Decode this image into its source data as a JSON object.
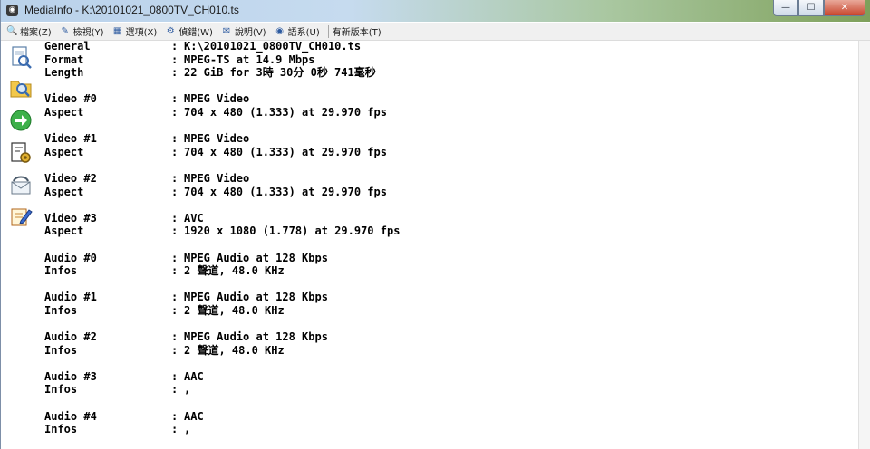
{
  "window": {
    "title": "MediaInfo - K:\\20101021_0800TV_CH010.ts",
    "controls": {
      "minimize": "—",
      "maximize": "☐",
      "close": "✕"
    }
  },
  "menu": [
    {
      "label": "檔案(Z)",
      "icon": "folder-search-icon",
      "glyph": "🔍"
    },
    {
      "label": "檢視(Y)",
      "icon": "view-icon",
      "glyph": "✎"
    },
    {
      "label": "選項(X)",
      "icon": "options-icon",
      "glyph": "▦"
    },
    {
      "label": "偵錯(W)",
      "icon": "debug-icon",
      "glyph": "⚙"
    },
    {
      "label": "說明(V)",
      "icon": "help-icon",
      "glyph": "✉"
    },
    {
      "label": "語系(U)",
      "icon": "language-icon",
      "glyph": "◉"
    },
    {
      "label": "有新版本(T)",
      "icon": "",
      "glyph": ""
    }
  ],
  "sidebar": [
    {
      "name": "open-file-icon"
    },
    {
      "name": "open-folder-icon"
    },
    {
      "name": "export-arrow-icon"
    },
    {
      "name": "preferences-icon"
    },
    {
      "name": "contact-icon"
    },
    {
      "name": "edit-icon"
    }
  ],
  "info": [
    {
      "key": "General",
      "value": "K:\\20101021_0800TV_CH010.ts"
    },
    {
      "key": "Format",
      "value": "MPEG-TS at 14.9 Mbps"
    },
    {
      "key": "Length",
      "value": "22 GiB for 3時 30分 0秒 741毫秒"
    },
    null,
    {
      "key": "Video #0",
      "value": "MPEG Video"
    },
    {
      "key": "Aspect",
      "value": "704 x 480 (1.333) at 29.970 fps"
    },
    null,
    {
      "key": "Video #1",
      "value": "MPEG Video"
    },
    {
      "key": "Aspect",
      "value": "704 x 480 (1.333) at 29.970 fps"
    },
    null,
    {
      "key": "Video #2",
      "value": "MPEG Video"
    },
    {
      "key": "Aspect",
      "value": "704 x 480 (1.333) at 29.970 fps"
    },
    null,
    {
      "key": "Video #3",
      "value": "AVC"
    },
    {
      "key": "Aspect",
      "value": "1920 x 1080 (1.778) at 29.970 fps"
    },
    null,
    {
      "key": "Audio #0",
      "value": "MPEG Audio at 128 Kbps"
    },
    {
      "key": "Infos",
      "value": "2 聲道, 48.0 KHz"
    },
    null,
    {
      "key": "Audio #1",
      "value": "MPEG Audio at 128 Kbps"
    },
    {
      "key": "Infos",
      "value": "2 聲道, 48.0 KHz"
    },
    null,
    {
      "key": "Audio #2",
      "value": "MPEG Audio at 128 Kbps"
    },
    {
      "key": "Infos",
      "value": "2 聲道, 48.0 KHz"
    },
    null,
    {
      "key": "Audio #3",
      "value": "AAC"
    },
    {
      "key": "Infos",
      "value": ","
    },
    null,
    {
      "key": "Audio #4",
      "value": "AAC"
    },
    {
      "key": "Infos",
      "value": ","
    }
  ],
  "separator": ":"
}
